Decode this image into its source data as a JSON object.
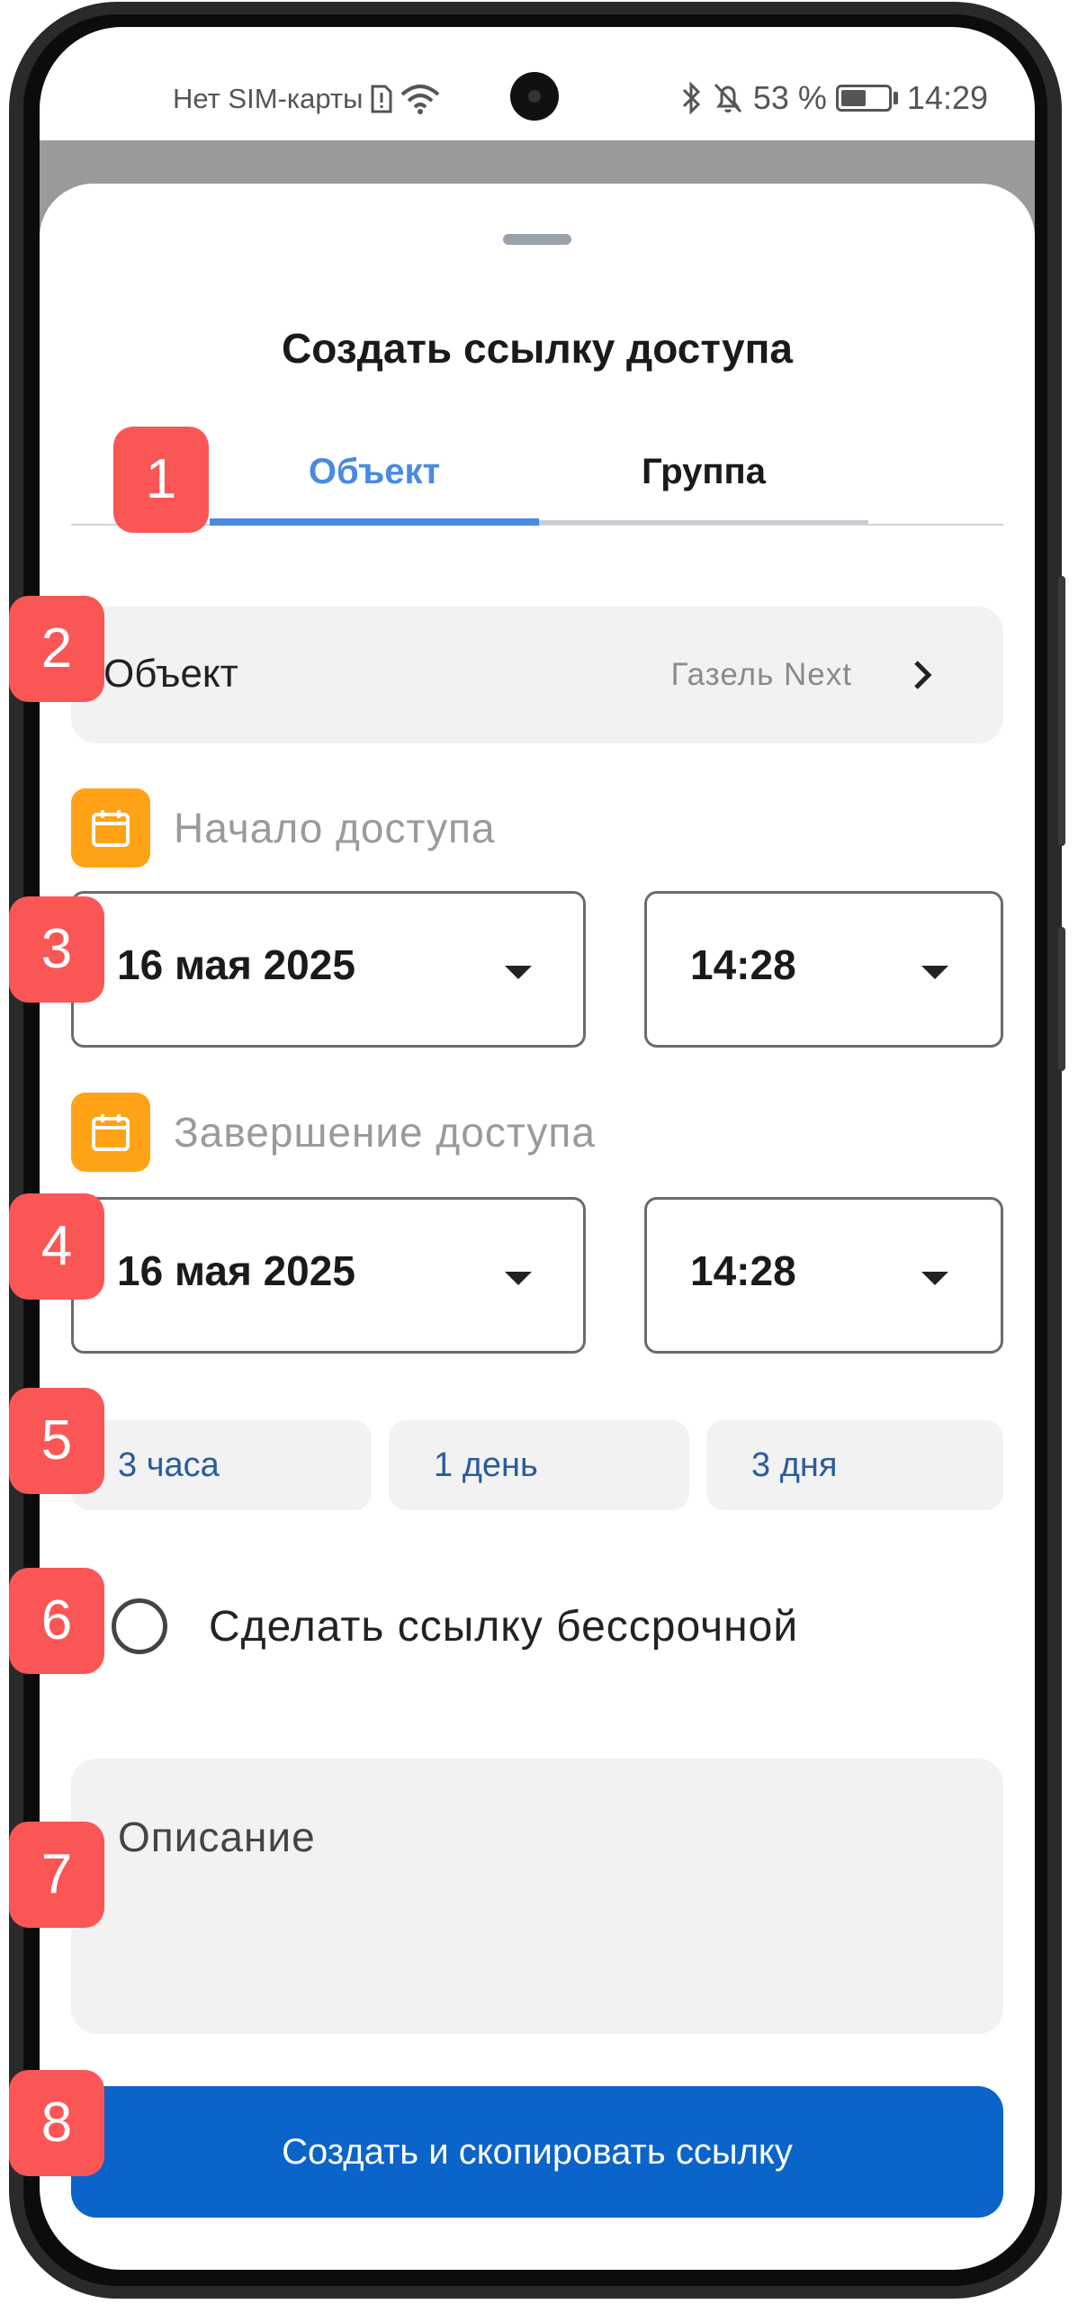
{
  "status_bar": {
    "carrier": "Нет SIM-карты",
    "battery_percent": "53 %",
    "battery_level": 0.53,
    "time": "14:29"
  },
  "sheet": {
    "title": "Создать ссылку доступа"
  },
  "tabs": [
    {
      "label": "Объект",
      "active": true
    },
    {
      "label": "Группа",
      "active": false
    }
  ],
  "object_row": {
    "label": "Объект",
    "value": "Газель Next"
  },
  "start_access": {
    "label": "Начало доступа",
    "date": "16 мая 2025",
    "time": "14:28"
  },
  "end_access": {
    "label": "Завершение доступа",
    "date": "16 мая 2025",
    "time": "14:28"
  },
  "quick_durations": [
    "3 часа",
    "1 день",
    "3 дня"
  ],
  "permanent_option": {
    "label": "Сделать ссылку бессрочной",
    "checked": false
  },
  "description": {
    "placeholder": "Описание"
  },
  "primary_button": {
    "label": "Создать и скопировать ссылку"
  },
  "annotations": [
    "1",
    "2",
    "3",
    "4",
    "5",
    "6",
    "7",
    "8"
  ],
  "colors": {
    "accent": "#4a8ae0",
    "primary_button": "#0a64c9",
    "calendar_icon": "#ffa216",
    "chip_text": "#2a5c9b",
    "annotation_badge": "#fa5656"
  }
}
